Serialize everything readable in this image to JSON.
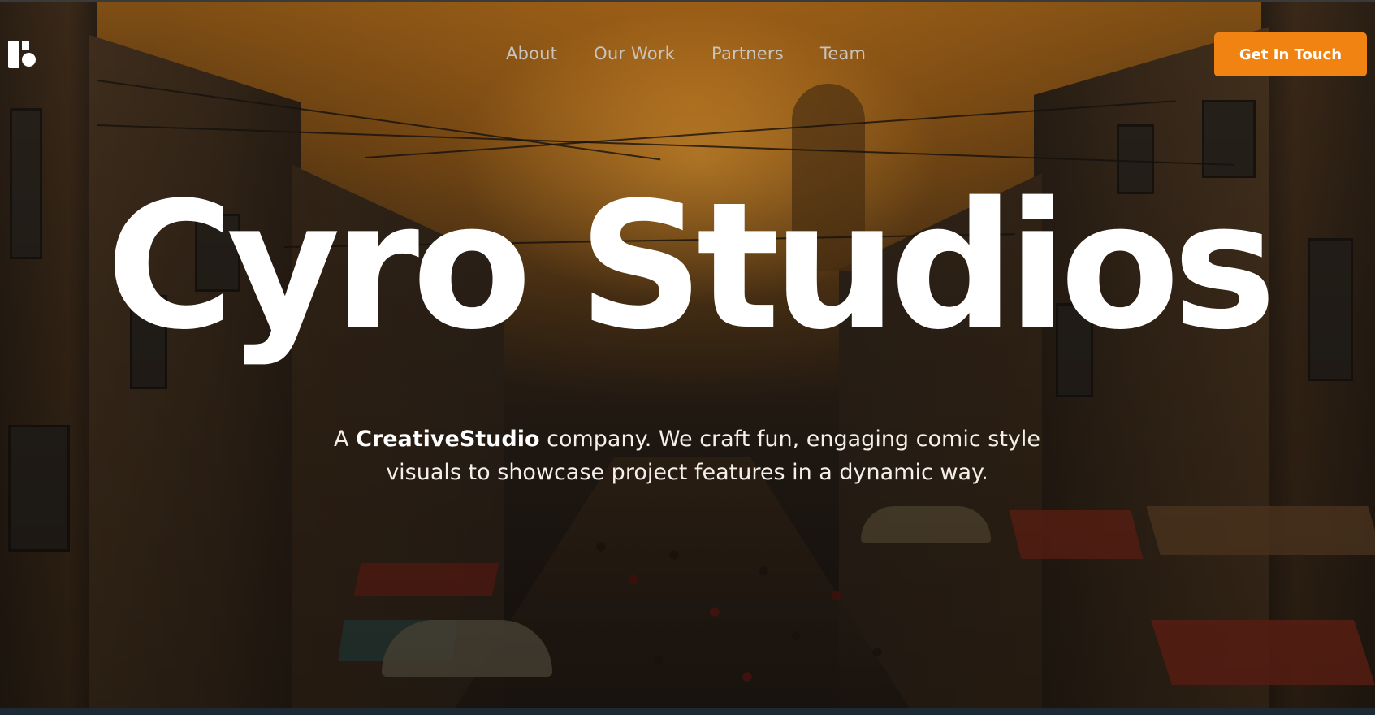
{
  "brand": {
    "logo_icon": "studio-logo-icon",
    "accent_color": "#f08312"
  },
  "nav": {
    "items": [
      {
        "label": "About"
      },
      {
        "label": "Our Work"
      },
      {
        "label": "Partners"
      },
      {
        "label": "Team"
      }
    ],
    "cta_label": "Get In Touch"
  },
  "hero": {
    "title": "Cyro Studios",
    "subtitle_prefix": "A",
    "subtitle_brand": "CreativeStudio",
    "subtitle_line1_rest": "company. We craft fun, engaging comic style",
    "subtitle_line2": "visuals to showcase project features in a dynamic way."
  }
}
